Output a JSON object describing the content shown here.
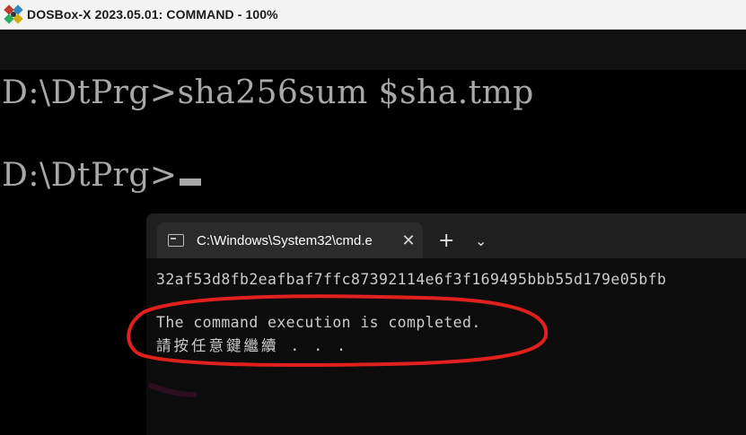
{
  "window": {
    "title": "DOSBox-X 2023.05.01: COMMAND - 100%",
    "icon": "dosbox-app-icon"
  },
  "dos": {
    "line1": "D:\\DtPrg>sha256sum $sha.tmp",
    "line2_prompt": "D:\\DtPrg>"
  },
  "terminal": {
    "tab_title": "C:\\Windows\\System32\\cmd.e",
    "tab_icon": "cmd-icon",
    "close_glyph": "✕",
    "new_tab_glyph": "+",
    "dropdown_glyph": "⌄",
    "output": {
      "hash": "32af53d8fb2eafbaf7ffc87392114e6f3f169495bbb55d179e05bfb",
      "message": "The command execution is completed.",
      "prompt_chinese": "請按任意鍵繼續 . . ."
    }
  },
  "annotation": {
    "color": "#e0201c",
    "shape": "ellipse-highlight"
  }
}
